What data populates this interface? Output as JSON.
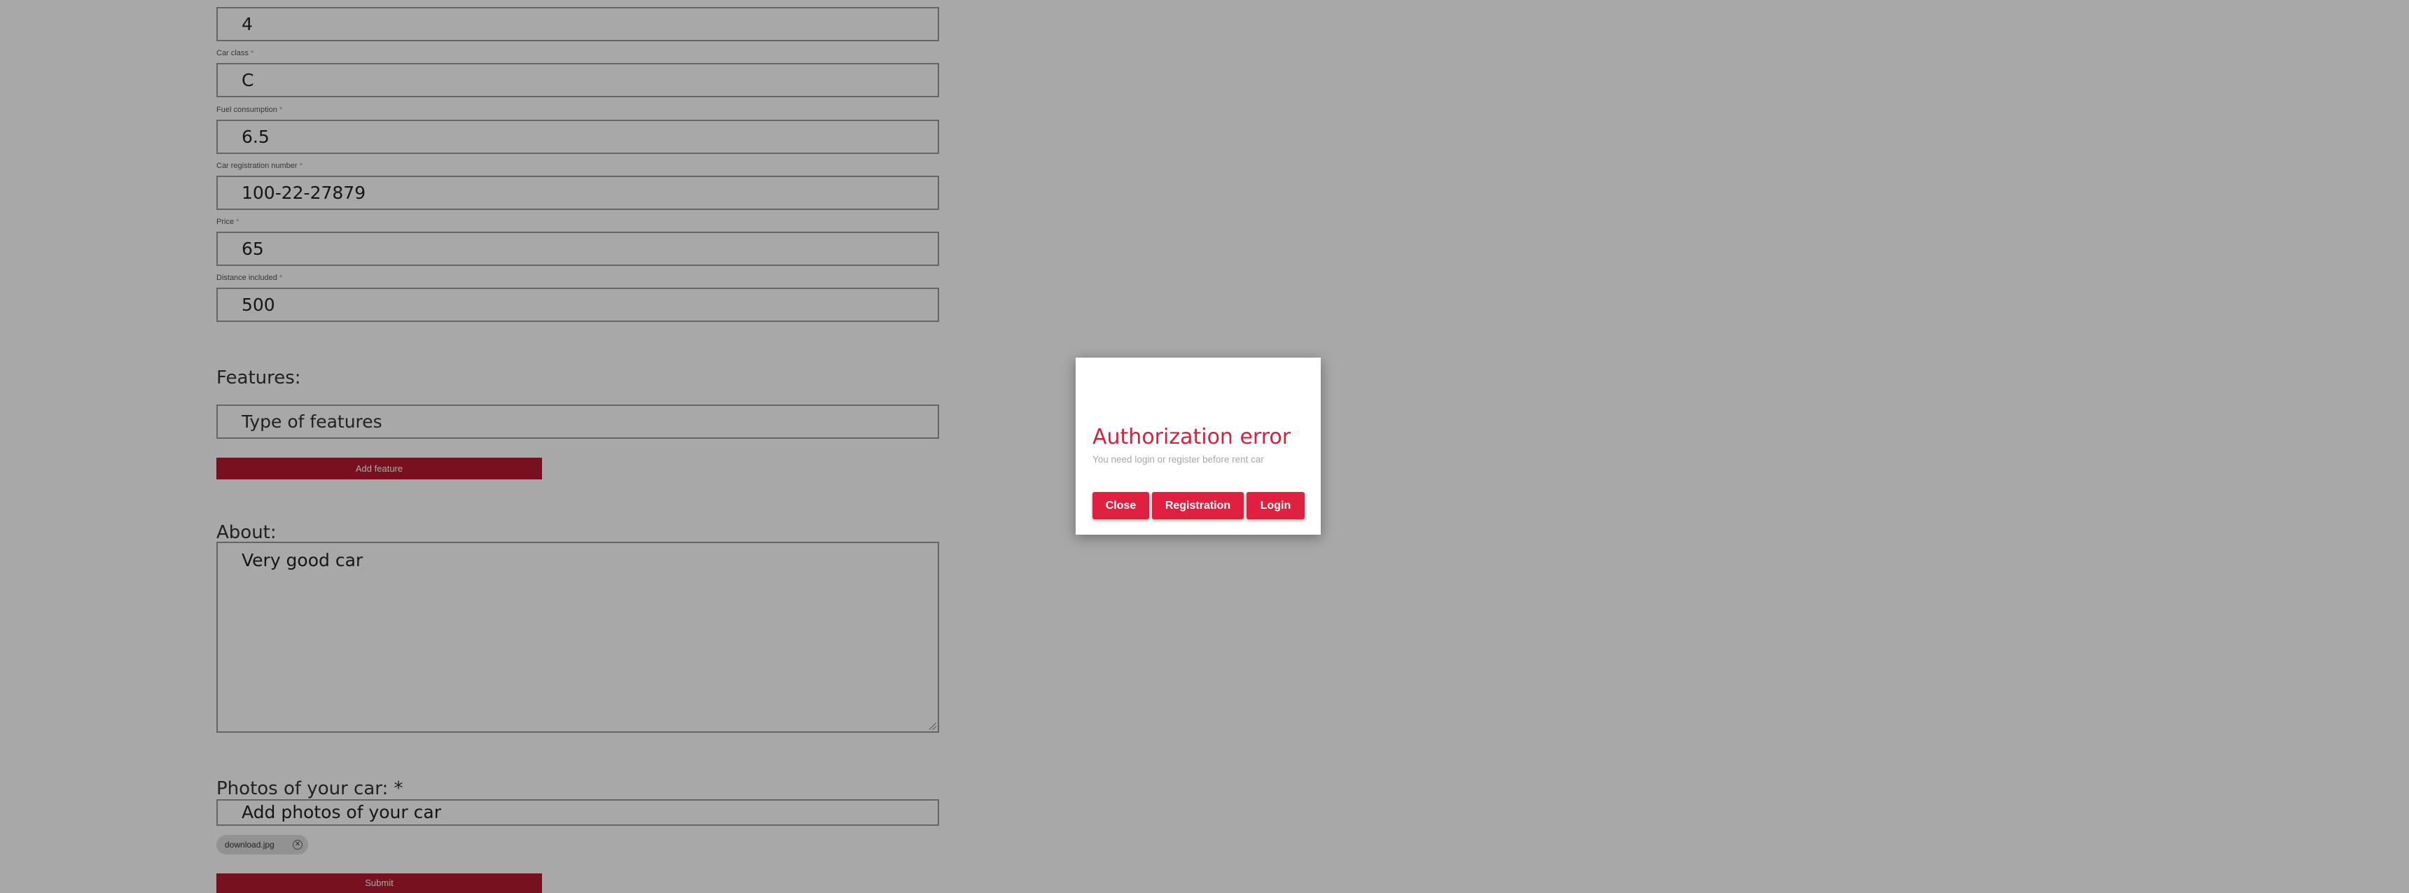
{
  "form": {
    "fields": [
      {
        "label": "",
        "required": false,
        "value": "4"
      },
      {
        "label": "Car class",
        "required": true,
        "value": "C"
      },
      {
        "label": "Fuel consumption",
        "required": true,
        "value": "6.5"
      },
      {
        "label": "Car registration number",
        "required": true,
        "value": "100-22-27879"
      },
      {
        "label": "Price",
        "required": true,
        "value": "65"
      },
      {
        "label": "Distance included",
        "required": true,
        "value": "500"
      }
    ],
    "required_mark": "*",
    "features_title": "Features:",
    "features_placeholder": "Type of features",
    "add_feature_label": "Add feature",
    "about_title": "About:",
    "about_value": "Very good car",
    "photos_title": "Photos of your car:",
    "photos_placeholder": "Add photos of your car",
    "photo_chip": "download.jpg",
    "submit_label": "Submit"
  },
  "modal": {
    "title": "Authorization error",
    "message": "You need login or register before rent car",
    "buttons": {
      "close": "Close",
      "registration": "Registration",
      "login": "Login"
    }
  },
  "colors": {
    "overlay": "rgba(0,0,0,0.34)",
    "accent_red": "#e0203f",
    "dark_red_button": "#b51a2f",
    "modal_title": "#d8203c"
  }
}
